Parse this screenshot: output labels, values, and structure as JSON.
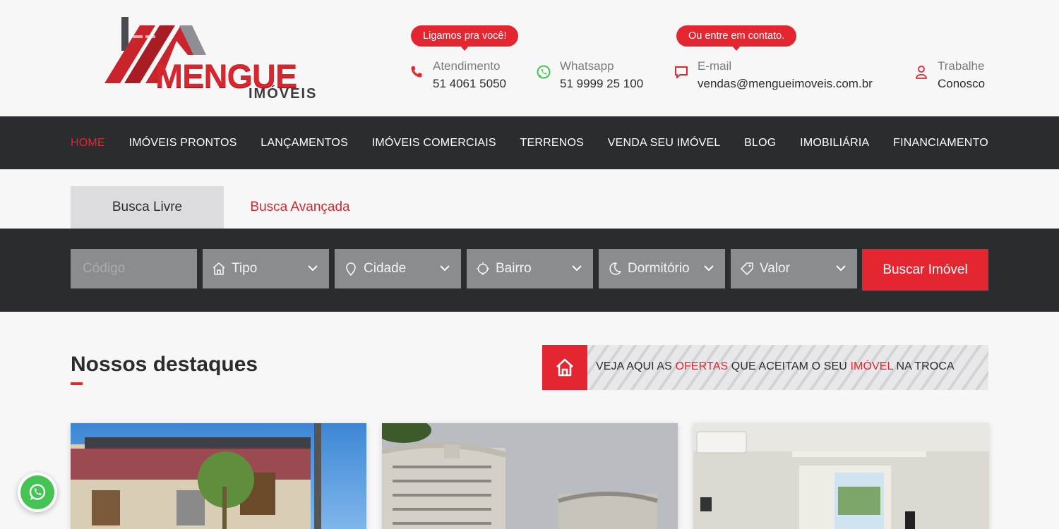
{
  "logo": {
    "name": "MENGUE",
    "sub": "IMÓVEIS"
  },
  "header": {
    "bubble_call": "Ligamos pra você!",
    "bubble_contact": "Ou entre em contato.",
    "contacts": [
      {
        "label": "Atendimento",
        "value": "51 4061 5050",
        "icon": "phone-icon"
      },
      {
        "label": "Whatsapp",
        "value": "51 9999 25 100",
        "icon": "whatsapp-icon"
      },
      {
        "label": "E-mail",
        "value": "vendas@mengueimoveis.com.br",
        "icon": "chat-icon"
      },
      {
        "label": "Trabalhe",
        "value": "Conosco",
        "icon": "user-icon"
      }
    ]
  },
  "nav": {
    "items": [
      {
        "label": "HOME",
        "active": true
      },
      {
        "label": "IMÓVEIS PRONTOS"
      },
      {
        "label": "LANÇAMENTOS"
      },
      {
        "label": "IMÓVEIS COMERCIAIS"
      },
      {
        "label": "TERRENOS"
      },
      {
        "label": "VENDA SEU IMÓVEL"
      },
      {
        "label": "BLOG"
      },
      {
        "label": "IMOBILIÁRIA"
      },
      {
        "label": "FINANCIAMENTO"
      }
    ]
  },
  "search": {
    "tab_livre": "Busca Livre",
    "tab_avancada": "Busca Avançada",
    "codigo_placeholder": "Código",
    "tipo": "Tipo",
    "cidade": "Cidade",
    "bairro": "Bairro",
    "dormitorio": "Dormitório",
    "valor": "Valor",
    "button": "Buscar Imóvel"
  },
  "featured": {
    "title": "Nossos destaques",
    "banner_1": "VEJA AQUI AS ",
    "banner_2": "OFERTAS",
    "banner_3": " QUE ACEITAM O SEU ",
    "banner_4": "IMÓVEL",
    "banner_5": " NA TROCA"
  },
  "colors": {
    "accent": "#e3262f",
    "dark": "#2b2c30",
    "field": "#8b8c90",
    "whatsapp": "#44c553"
  }
}
